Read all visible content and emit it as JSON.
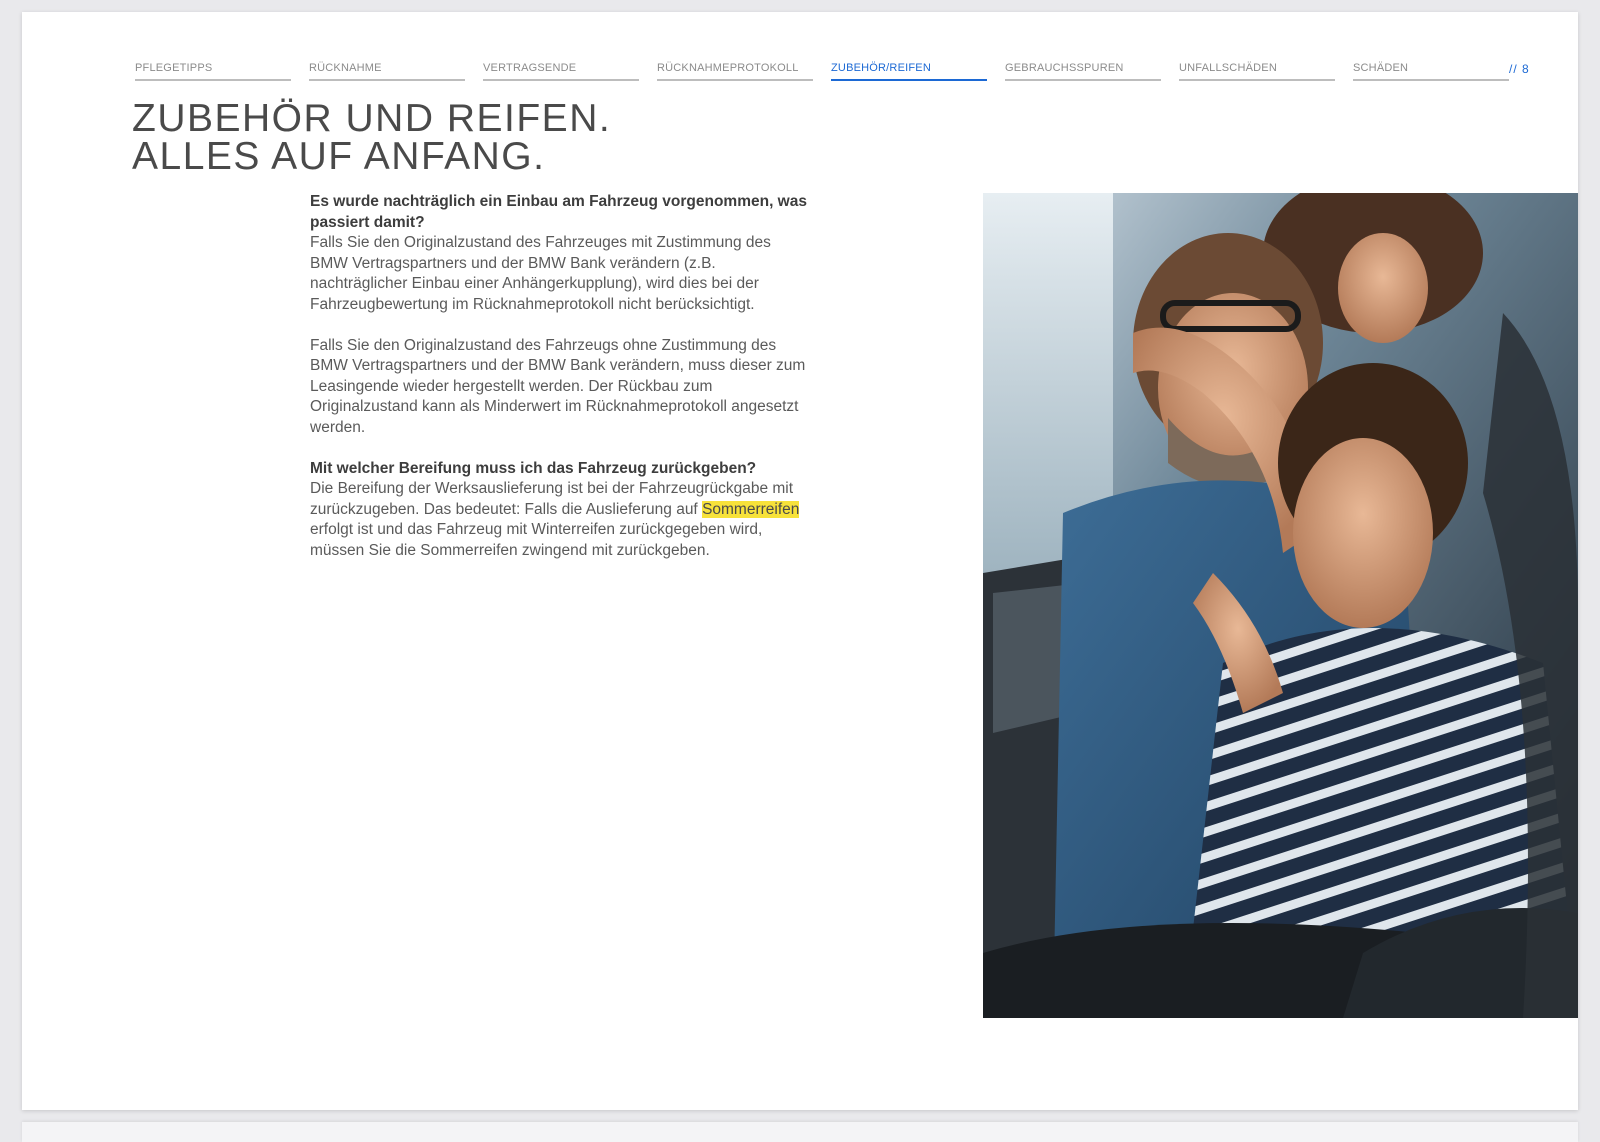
{
  "nav": {
    "items": [
      {
        "label": "PFLEGETIPPS",
        "active": false
      },
      {
        "label": "RÜCKNAHME",
        "active": false
      },
      {
        "label": "VERTRAGSENDE",
        "active": false
      },
      {
        "label": "RÜCKNAHMEPROTOKOLL",
        "active": false
      },
      {
        "label": "ZUBEHÖR/REIFEN",
        "active": true
      },
      {
        "label": "GEBRAUCHSSPUREN",
        "active": false
      },
      {
        "label": "UNFALLSCHÄDEN",
        "active": false
      },
      {
        "label": "SCHÄDEN",
        "active": false
      }
    ],
    "page_number": "// 8"
  },
  "title": {
    "line1": "ZUBEHÖR UND REIFEN.",
    "line2": "ALLES AUF ANFANG."
  },
  "content": {
    "q1_heading": "Es wurde nachträglich ein Einbau am Fahrzeug vorgenommen, was passiert damit?",
    "q1_para1": "Falls Sie den Originalzustand des Fahrzeuges mit Zustimmung des BMW Vertragspartners und der BMW Bank verändern (z.B. nachträglicher Einbau einer Anhängerkupplung), wird dies bei der Fahrzeugbewertung im Rücknahmeprotokoll nicht berücksichtigt.",
    "q1_para2": "Falls Sie den Originalzustand des Fahrzeugs ohne Zustimmung des BMW Vertragspartners und der BMW Bank verändern, muss dieser zum Leasingende wieder hergestellt werden. Der Rückbau zum Originalzustand kann als Minderwert im Rücknahmeprotokoll angesetzt werden.",
    "q2_heading": "Mit welcher Bereifung muss ich das Fahrzeug zurückgeben?",
    "q2_para_before": "Die Bereifung der Werksauslieferung ist bei der Fahrzeugrückgabe mit zurückzugeben. Das bedeutet: Falls die Auslieferung auf ",
    "q2_para_highlight": "Sommerreifen",
    "q2_para_after": " erfolgt ist und das Fahrzeug mit Winterreifen zurückgegeben wird, müssen Sie die Sommerreifen zwingend mit zurückgeben."
  },
  "colors": {
    "accent": "#1c69d4",
    "highlight": "#f7e23a"
  }
}
